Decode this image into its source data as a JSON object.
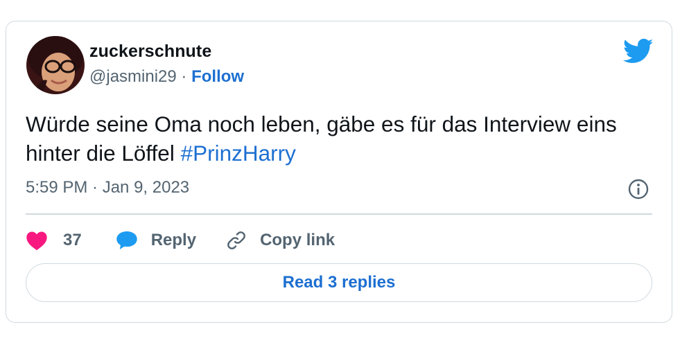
{
  "author": {
    "display_name": "zuckerschnute",
    "handle": "@jasmini29",
    "separator": " · ",
    "follow_label": "Follow"
  },
  "tweet": {
    "text": "Würde seine Oma noch leben, gäbe es für das Interview eins hinter die Löffel ",
    "hashtag": "#PrinzHarry",
    "timestamp": "5:59 PM · Jan 9, 2023"
  },
  "actions": {
    "like_count": "37",
    "reply_label": "Reply",
    "copy_link_label": "Copy link"
  },
  "read_replies_label": "Read 3 replies",
  "icons": {
    "brand": "twitter-bird-icon",
    "info": "info-icon",
    "like": "heart-icon",
    "reply": "speech-bubble-icon",
    "copy": "link-icon"
  },
  "colors": {
    "twitter_blue": "#1d9bf0",
    "link_blue": "#1d6fd1",
    "like_pink": "#f91880",
    "text_primary": "#0f1419",
    "text_secondary": "#536471",
    "border": "#cfd9de"
  }
}
